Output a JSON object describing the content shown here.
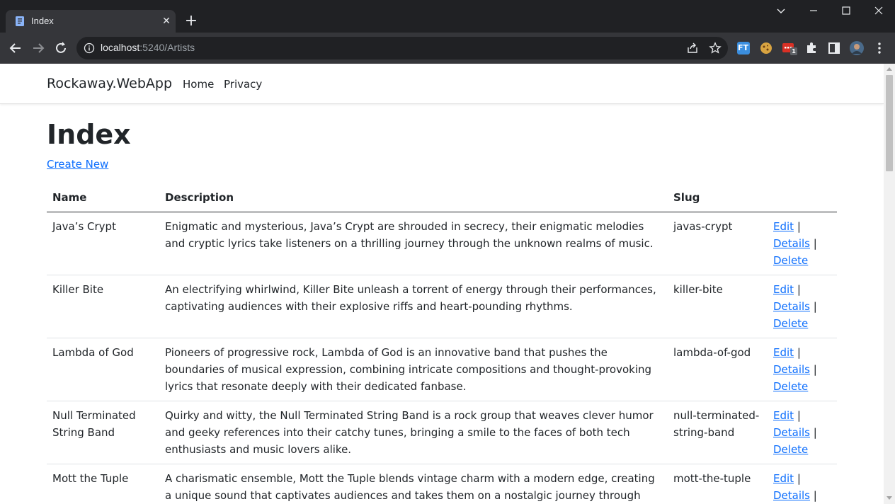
{
  "browser": {
    "tab_title": "Index",
    "url_host": "localhost",
    "url_path": ":5240/Artists",
    "extension_badge": "1",
    "extension_ft_label": "FT"
  },
  "site": {
    "brand": "Rockaway.WebApp",
    "nav": [
      "Home",
      "Privacy"
    ]
  },
  "page": {
    "title": "Index",
    "create_link": "Create New"
  },
  "table": {
    "headers": [
      "Name",
      "Description",
      "Slug",
      ""
    ],
    "action_labels": {
      "edit": "Edit",
      "details": "Details",
      "delete": "Delete",
      "separator": " |"
    },
    "rows": [
      {
        "name": "Java’s Crypt",
        "description": "Enigmatic and mysterious, Java’s Crypt are shrouded in secrecy, their enigmatic melodies and cryptic lyrics take listeners on a thrilling journey through the unknown realms of music.",
        "slug": "javas-crypt"
      },
      {
        "name": "Killer Bite",
        "description": "An electrifying whirlwind, Killer Bite unleash a torrent of energy through their performances, captivating audiences with their explosive riffs and heart-pounding rhythms.",
        "slug": "killer-bite"
      },
      {
        "name": "Lambda of God",
        "description": "Pioneers of progressive rock, Lambda of God is an innovative band that pushes the boundaries of musical expression, combining intricate compositions and thought-provoking lyrics that resonate deeply with their dedicated fanbase.",
        "slug": "lambda-of-god"
      },
      {
        "name": "Null Terminated String Band",
        "description": "Quirky and witty, the Null Terminated String Band is a rock group that weaves clever humor and geeky references into their catchy tunes, bringing a smile to the faces of both tech enthusiasts and music lovers alike.",
        "slug": "null-terminated-string-band"
      },
      {
        "name": "Mott the Tuple",
        "description": "A charismatic ensemble, Mott the Tuple blends vintage charm with a modern edge, creating a unique sound that captivates audiences and takes them on a nostalgic journey through time.",
        "slug": "mott-the-tuple"
      }
    ]
  },
  "colors": {
    "link": "#0d6efd",
    "chrome_dark": "#202124",
    "chrome_toolbar": "#35363a"
  }
}
